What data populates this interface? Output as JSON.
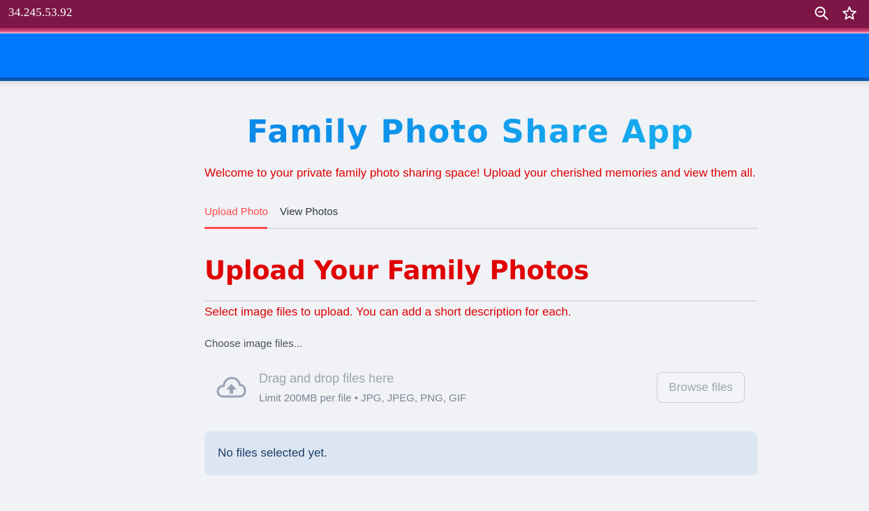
{
  "browser": {
    "url": "34.245.53.92",
    "icons": [
      "zoom-icon",
      "star-icon"
    ]
  },
  "app": {
    "title": "Family Photo Share App",
    "welcome": "Welcome to your private family photo sharing space! Upload your cherished memories and view them all."
  },
  "tabs": [
    {
      "label": "Upload Photo",
      "active": true
    },
    {
      "label": "View Photos",
      "active": false
    }
  ],
  "upload": {
    "title": "Upload Your Family Photos",
    "description": "Select image files to upload. You can add a short description for each.",
    "uploader_label": "Choose image files...",
    "drop_title": "Drag and drop files here",
    "drop_limit": "Limit 200MB per file • JPG, JPEG, PNG, GIF",
    "browse_label": "Browse files",
    "upload_icon": "cloud-upload-icon"
  },
  "info": {
    "message": "No files selected yet."
  },
  "colors": {
    "browser_bar": "#7b1646",
    "header": "#0078fe",
    "accent_red": "#e00000",
    "tab_active": "#ff4b4b",
    "info_bg": "#dce6f3"
  }
}
